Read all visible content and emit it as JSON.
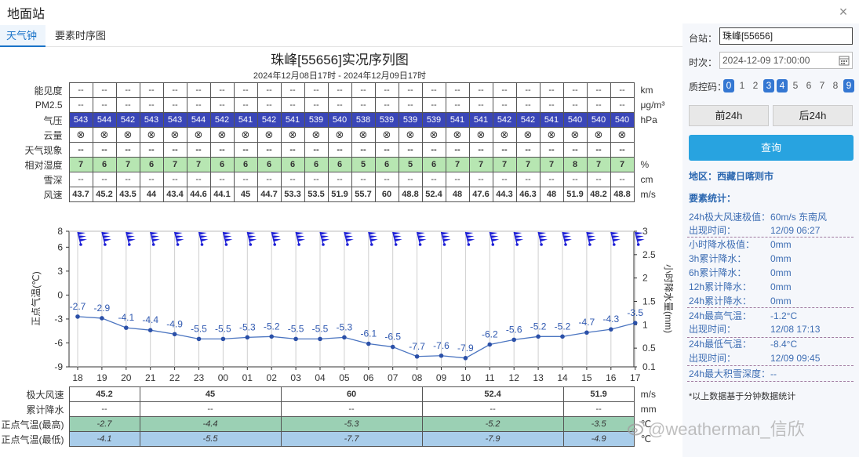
{
  "window": {
    "title": "地面站",
    "close": "×"
  },
  "tabs": [
    {
      "label": "天气钟"
    },
    {
      "label": "要素时序图"
    }
  ],
  "header": {
    "title": "珠峰[55656]实况序列图",
    "subtitle": "2024年12月08日17时 - 2024年12月09日17时"
  },
  "colors": {
    "pressure_bg": "#3a46b8",
    "humidity_bg": "#b7e6b2",
    "temp_max_bg": "#9bd0b4",
    "temp_min_bg": "#a9cdea",
    "accent": "#3477d2",
    "line": "#4a74c0",
    "barb": "#1d1fd6"
  },
  "top_table": {
    "rows": [
      {
        "label": "能见度",
        "unit": "km",
        "style": "plain",
        "values": [
          "--",
          "--",
          "--",
          "--",
          "--",
          "--",
          "--",
          "--",
          "--",
          "--",
          "--",
          "--",
          "--",
          "--",
          "--",
          "--",
          "--",
          "--",
          "--",
          "--",
          "--",
          "--",
          "--",
          "--",
          "--"
        ]
      },
      {
        "label": "PM2.5",
        "unit": "μg/m³",
        "style": "plain",
        "values": [
          "--",
          "--",
          "--",
          "--",
          "--",
          "--",
          "--",
          "--",
          "--",
          "--",
          "--",
          "--",
          "--",
          "--",
          "--",
          "--",
          "--",
          "--",
          "--",
          "--",
          "--",
          "--",
          "--",
          "--",
          "--"
        ]
      },
      {
        "label": "气压",
        "unit": "hPa",
        "style": "pressure",
        "values": [
          "543",
          "544",
          "542",
          "543",
          "543",
          "544",
          "542",
          "541",
          "542",
          "541",
          "539",
          "540",
          "538",
          "539",
          "539",
          "539",
          "541",
          "541",
          "542",
          "542",
          "541",
          "540",
          "540",
          "540"
        ]
      },
      {
        "label": "云量",
        "unit": "",
        "style": "cloud",
        "values": [
          "⊗",
          "⊗",
          "⊗",
          "⊗",
          "⊗",
          "⊗",
          "⊗",
          "⊗",
          "⊗",
          "⊗",
          "⊗",
          "⊗",
          "⊗",
          "⊗",
          "⊗",
          "⊗",
          "⊗",
          "⊗",
          "⊗",
          "⊗",
          "⊗",
          "⊗",
          "⊗",
          "⊗"
        ]
      },
      {
        "label": "天气现象",
        "unit": "",
        "style": "bold",
        "values": [
          "--",
          "--",
          "--",
          "--",
          "--",
          "--",
          "--",
          "--",
          "--",
          "--",
          "--",
          "--",
          "--",
          "--",
          "--",
          "--",
          "--",
          "--",
          "--",
          "--",
          "--",
          "--",
          "--",
          "--"
        ]
      },
      {
        "label": "相对湿度",
        "unit": "%",
        "style": "humidity",
        "values": [
          "7",
          "6",
          "7",
          "6",
          "7",
          "7",
          "6",
          "6",
          "6",
          "6",
          "6",
          "6",
          "5",
          "6",
          "5",
          "6",
          "7",
          "7",
          "7",
          "7",
          "7",
          "8",
          "7",
          "7"
        ]
      },
      {
        "label": "雪深",
        "unit": "cm",
        "style": "plain",
        "values": [
          "--",
          "--",
          "--",
          "--",
          "--",
          "--",
          "--",
          "--",
          "--",
          "--",
          "--",
          "--",
          "--",
          "--",
          "--",
          "--",
          "--",
          "--",
          "--",
          "--",
          "--",
          "--",
          "--",
          "--"
        ]
      },
      {
        "label": "风速",
        "unit": "m/s",
        "style": "bold",
        "values": [
          "43.7",
          "45.2",
          "43.5",
          "44",
          "43.4",
          "44.6",
          "44.1",
          "45",
          "44.7",
          "53.3",
          "53.5",
          "51.9",
          "55.7",
          "60",
          "48.8",
          "52.4",
          "48",
          "47.6",
          "44.3",
          "46.3",
          "48",
          "51.9",
          "48.2",
          "48.8"
        ]
      }
    ]
  },
  "bottom_table": {
    "rows": [
      {
        "label": "极大风速",
        "unit": "m/s",
        "style": "bold",
        "cells": [
          {
            "span": 3,
            "v": "45.2"
          },
          {
            "span": 6,
            "v": "45"
          },
          {
            "span": 6,
            "v": "60"
          },
          {
            "span": 6,
            "v": "52.4"
          },
          {
            "span": 3,
            "v": "51.9"
          }
        ]
      },
      {
        "label": "累计降水",
        "unit": "mm",
        "style": "plain",
        "cells": [
          {
            "span": 3,
            "v": "--"
          },
          {
            "span": 6,
            "v": "--"
          },
          {
            "span": 6,
            "v": "--"
          },
          {
            "span": 6,
            "v": "--"
          },
          {
            "span": 3,
            "v": "--"
          }
        ]
      },
      {
        "label": "正点气温(最高)",
        "unit": "℃",
        "style": "tmax",
        "cells": [
          {
            "span": 3,
            "v": "-2.7"
          },
          {
            "span": 6,
            "v": "-4.4"
          },
          {
            "span": 6,
            "v": "-5.3"
          },
          {
            "span": 6,
            "v": "-5.2"
          },
          {
            "span": 3,
            "v": "-3.5"
          }
        ]
      },
      {
        "label": "正点气温(最低)",
        "unit": "℃",
        "style": "tmin",
        "cells": [
          {
            "span": 3,
            "v": "-4.1"
          },
          {
            "span": 6,
            "v": "-5.5"
          },
          {
            "span": 6,
            "v": "-7.7"
          },
          {
            "span": 6,
            "v": "-7.9"
          },
          {
            "span": 3,
            "v": "-4.9"
          }
        ]
      }
    ]
  },
  "chart_data": {
    "type": "line",
    "x": [
      "18",
      "19",
      "20",
      "21",
      "22",
      "23",
      "00",
      "01",
      "02",
      "03",
      "04",
      "05",
      "06",
      "07",
      "08",
      "09",
      "10",
      "11",
      "12",
      "13",
      "14",
      "15",
      "16",
      "17"
    ],
    "series": [
      {
        "values": [
          -2.7,
          -2.9,
          -4.1,
          -4.4,
          -4.9,
          -5.5,
          -5.5,
          -5.3,
          -5.2,
          -5.5,
          -5.5,
          -5.3,
          -6.1,
          -6.5,
          -7.7,
          -7.6,
          -7.9,
          -6.2,
          -5.6,
          -5.2,
          -5.2,
          -4.7,
          -4.3,
          -3.5
        ]
      }
    ],
    "wind_barbs": 24,
    "ylabel": "正点气温(℃)",
    "y2label": "小时降水量(mm)",
    "ylim": [
      -9,
      8
    ],
    "y2lim": [
      0.1,
      3
    ],
    "yticks": [
      "8",
      "6",
      "3",
      "0",
      "-3",
      "-6",
      "-9"
    ],
    "y2ticks": [
      "3",
      "2.5",
      "2",
      "1.5",
      "1",
      "0.5",
      "0.1"
    ],
    "grid": "vertical"
  },
  "side": {
    "station_label": "台站：",
    "station_value": "珠峰[55656]",
    "time_label": "时次：",
    "time_value": "2024-12-09 17:00:00",
    "qc_label": "质控码：",
    "qc": [
      {
        "v": "0",
        "on": true
      },
      {
        "v": "1",
        "on": false
      },
      {
        "v": "2",
        "on": false
      },
      {
        "v": "3",
        "on": true
      },
      {
        "v": "4",
        "on": true
      },
      {
        "v": "5",
        "on": false
      },
      {
        "v": "6",
        "on": false
      },
      {
        "v": "7",
        "on": false
      },
      {
        "v": "8",
        "on": false
      },
      {
        "v": "9",
        "on": true
      }
    ],
    "prev_btn": "前24h",
    "next_btn": "后24h",
    "query_btn": "查询",
    "region": "地区：西藏日喀则市",
    "stats_head": "要素统计：",
    "stats": [
      {
        "k": "24h极大风速极值：",
        "v": "60m/s 东南风",
        "full": true
      },
      {
        "k": "出现时间：",
        "v": "12/09 06:27"
      },
      {
        "k": "小时降水极值：",
        "v": "0mm"
      },
      {
        "k": "3h累计降水：",
        "v": "0mm"
      },
      {
        "k": "6h累计降水：",
        "v": "0mm"
      },
      {
        "k": "12h累计降水：",
        "v": "0mm"
      },
      {
        "k": "24h累计降水：",
        "v": "0mm"
      },
      {
        "k": "24h最高气温：",
        "v": "-1.2°C"
      },
      {
        "k": "出现时间：",
        "v": "12/08 17:13"
      },
      {
        "k": "24h最低气温：",
        "v": "-8.4°C"
      },
      {
        "k": "出现时间：",
        "v": "12/09 09:45"
      },
      {
        "k": "24h最大积雪深度：--",
        "v": "",
        "full": true
      }
    ],
    "footnote": "*以上数据基于分钟数据统计"
  },
  "watermark": "@weatherman_信欣"
}
